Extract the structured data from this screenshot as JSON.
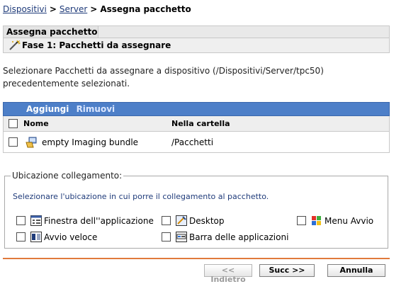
{
  "breadcrumb": {
    "items": [
      "Dispositivi",
      "Server"
    ],
    "separator": ">",
    "current": "Assegna pacchetto"
  },
  "wizard": {
    "title": "Assegna pacchetto",
    "step": "Fase 1: Pacchetti da assegnare"
  },
  "description": "Selezionare Pacchetti da assegnare a dispositivo (/Dispositivi/Server/tpc50) precedentemente selezionati.",
  "table": {
    "actions": {
      "add": "Aggiungi",
      "remove": "Rimuovi"
    },
    "columns": {
      "name": "Nome",
      "folder": "Nella cartella"
    },
    "rows": [
      {
        "name": "empty Imaging bundle",
        "folder": "/Pacchetti",
        "icon": "bundle-icon",
        "checked": false
      }
    ],
    "header_color": "#4d7fc8"
  },
  "location": {
    "legend": "Ubicazione collegamento:",
    "instructions": "Selezionare l'ubicazione in cui porre il collegamento al pacchetto.",
    "options": [
      {
        "label": "Finestra dell''applicazione",
        "icon": "app-window-icon",
        "checked": false
      },
      {
        "label": "Desktop",
        "icon": "desktop-icon",
        "checked": false
      },
      {
        "label": "Menu Avvio",
        "icon": "start-menu-icon",
        "checked": false
      },
      {
        "label": "Avvio veloce",
        "icon": "quick-launch-icon",
        "checked": false
      },
      {
        "label": "Barra delle applicazioni",
        "icon": "taskbar-icon",
        "checked": false
      }
    ]
  },
  "buttons": {
    "back": "<< Indietro",
    "next": "Succ >>",
    "cancel": "Annulla"
  },
  "accent_color": "#e07a3c"
}
